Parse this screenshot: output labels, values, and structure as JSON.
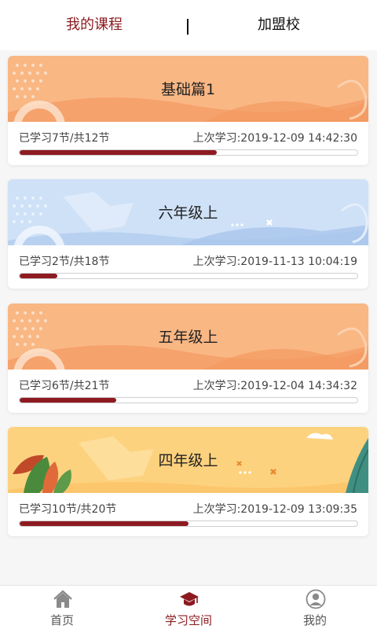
{
  "tabs": {
    "my_courses": "我的课程",
    "join_school": "加盟校"
  },
  "courses": [
    {
      "title": "基础篇1",
      "progress_text": "已学习7节/共12节",
      "last_study": "上次学习:2019-12-09 14:42:30",
      "completed": 7,
      "total": 12,
      "theme": "orange"
    },
    {
      "title": "六年级上",
      "progress_text": "已学习2节/共18节",
      "last_study": "上次学习:2019-11-13 10:04:19",
      "completed": 2,
      "total": 18,
      "theme": "blue"
    },
    {
      "title": "五年级上",
      "progress_text": "已学习6节/共21节",
      "last_study": "上次学习:2019-12-04 14:34:32",
      "completed": 6,
      "total": 21,
      "theme": "orange"
    },
    {
      "title": "四年级上",
      "progress_text": "已学习10节/共20节",
      "last_study": "上次学习:2019-12-09 13:09:35",
      "completed": 10,
      "total": 20,
      "theme": "yellow"
    }
  ],
  "bottom_nav": {
    "home": "首页",
    "study_space": "学习空间",
    "mine": "我的"
  },
  "colors": {
    "accent": "#8b1a1f",
    "progress_fill": "#8e1b22"
  },
  "icons": {
    "home": "home-icon",
    "study_space": "graduation-cap-icon",
    "mine": "user-icon"
  }
}
